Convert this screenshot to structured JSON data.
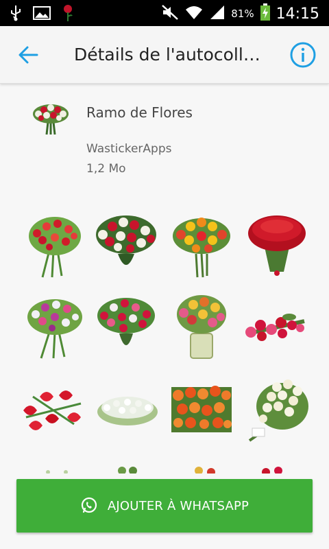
{
  "status_bar": {
    "battery": "81%",
    "time": "14:15"
  },
  "header": {
    "title": "Détails de l'autocoll…"
  },
  "pack": {
    "name": "Ramo de Flores",
    "publisher": "WastickerApps",
    "size": "1,2 Mo"
  },
  "actions": {
    "add_label": "AJOUTER À WHATSAPP"
  },
  "colors": {
    "accent": "#1e9fe3",
    "cta": "#3fae39"
  }
}
